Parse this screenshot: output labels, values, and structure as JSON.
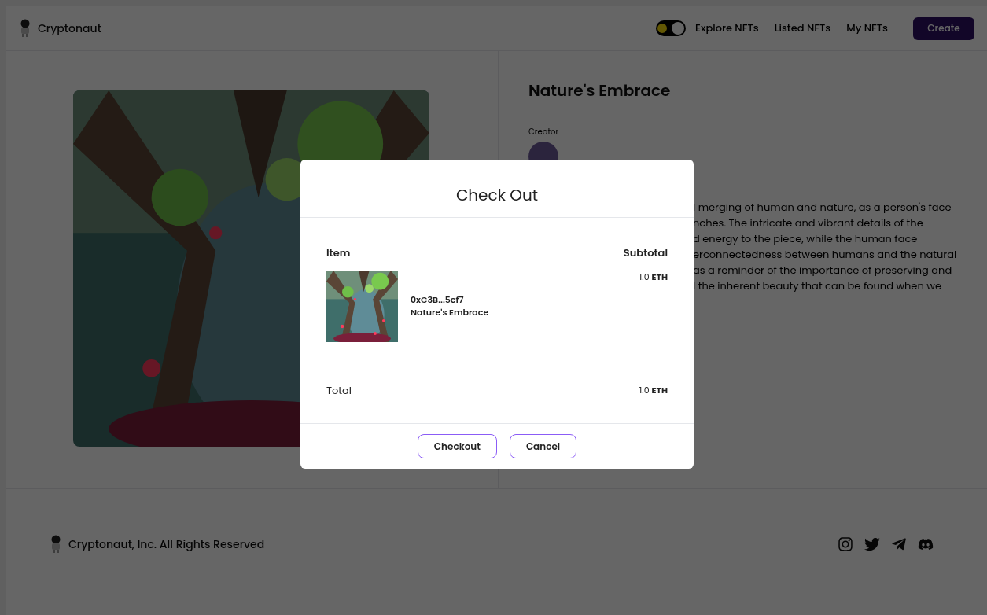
{
  "nav": {
    "brand": "Cryptonaut",
    "theme_toggle": {
      "on": false
    },
    "links": [
      {
        "label": "Explore NFTs",
        "selected": false
      },
      {
        "label": "Listed NFTs",
        "selected": false
      },
      {
        "label": "My NFTs",
        "selected": false
      }
    ],
    "create_button": "Create"
  },
  "detail": {
    "title": "Nature's Embrace",
    "creator_label": "Creator",
    "description_lines": [
      "l merging of human and nature, as a person's face",
      "nches. The intricate and vibrant details of the",
      "d energy to the piece, while the human face",
      "erconnectedness between humans and the natural",
      "as a reminder of the importance of preserving and",
      "l the inherent beauty that can be found when we"
    ]
  },
  "modal": {
    "title": "Check Out",
    "item_header": "Item",
    "subtotal_header": "Subtotal",
    "items": [
      {
        "creator": "0xC3B...5ef7",
        "name": "Nature's Embrace",
        "price": "1.0",
        "currency": "ETH"
      }
    ],
    "total_label": "Total",
    "total_price": "1.0",
    "total_currency": "ETH",
    "buttons": [
      "Checkout",
      "Cancel"
    ]
  },
  "footer": {
    "copyright": "Cryptonaut, Inc. All Rights Reserved"
  }
}
